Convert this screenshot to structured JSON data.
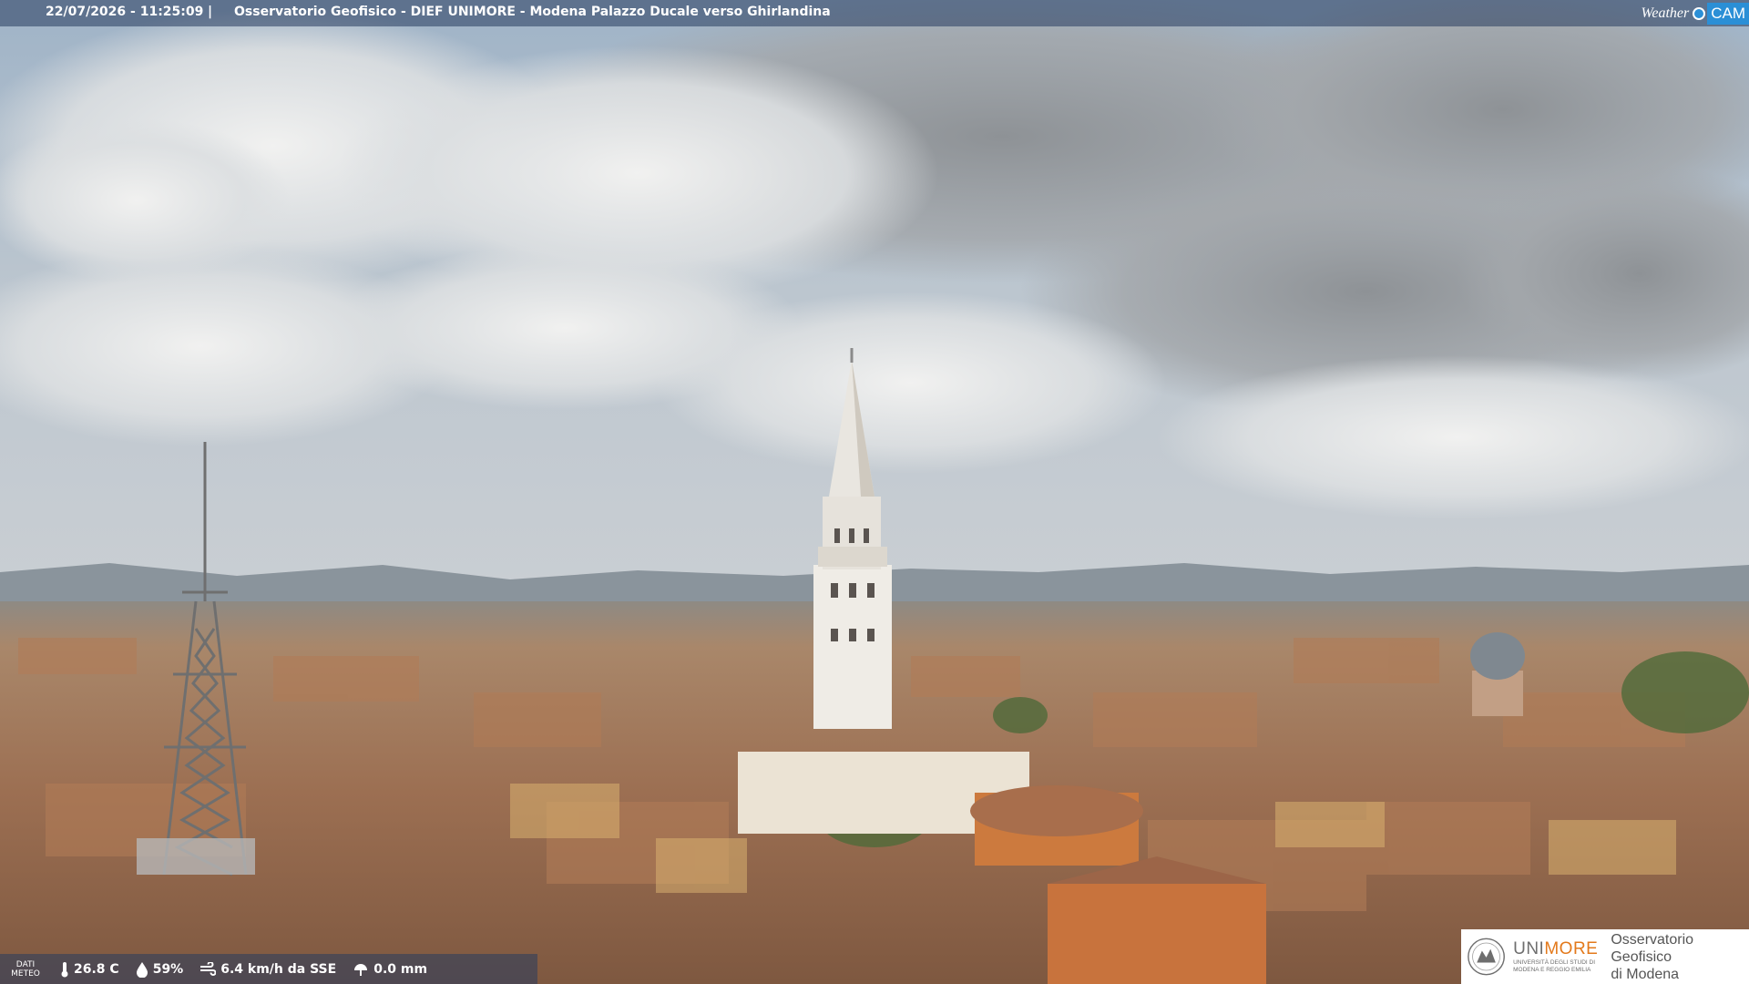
{
  "overlay": {
    "timestamp": "22/07/2026 - 11:25:09",
    "separator": "|",
    "camera_title": "Osservatorio Geofisico - DIEF UNIMORE - Modena Palazzo Ducale verso Ghirlandina",
    "brand_weather": "Weather",
    "brand_cam": "CAM"
  },
  "weather": {
    "label_line1": "DATI",
    "label_line2": "METEO",
    "temperature": "26.8 C",
    "humidity": "59%",
    "wind": "6.4 km/h da SSE",
    "rain": "0.0 mm"
  },
  "logo": {
    "uni_prefix": "UNI",
    "uni_suffix": "MORE",
    "uni_sub1": "UNIVERSITÀ DEGLI STUDI DI",
    "uni_sub2": "MODENA E REGGIO EMILIA",
    "obs_line1": "Osservatorio Geofisico",
    "obs_line2": "di Modena"
  },
  "colors": {
    "overlay_bar": "#283c5f",
    "brand_blue": "#2b8fd6",
    "unimore_orange": "#e3791b"
  }
}
